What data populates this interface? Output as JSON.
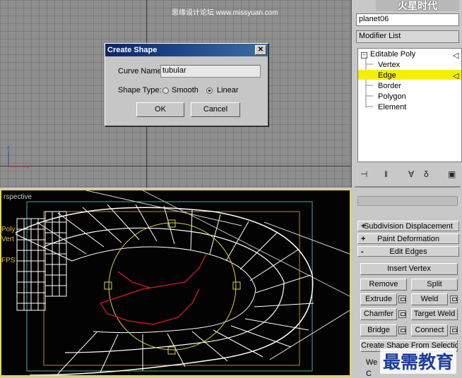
{
  "top_viewport": {
    "watermark": "思缘设计论坛 www.missyuan.com",
    "axis_z": "z",
    "axis_x": "x"
  },
  "dialog": {
    "title": "Create Shape",
    "close_glyph": "✕",
    "curve_name_label": "Curve Name:",
    "curve_name_value": "tubular",
    "shape_type_label": "Shape Type:",
    "option_smooth": "Smooth",
    "option_linear": "Linear",
    "selected_option": "Linear",
    "ok_label": "OK",
    "cancel_label": "Cancel"
  },
  "right_panel": {
    "logo_text": "火星时代",
    "object_name": "planet06",
    "modifier_list_label": "Modifier List",
    "stack": {
      "root": "Editable Poly",
      "items": [
        "Vertex",
        "Edge",
        "Border",
        "Polygon",
        "Element"
      ],
      "selected": "Edge"
    },
    "icons": [
      "pin-stack-icon",
      "show-end-result-icon",
      "make-unique-icon",
      "remove-modifier-icon",
      "configure-sets-icon"
    ],
    "rollouts": [
      {
        "sign": "+",
        "label": "Subdivision Displacement"
      },
      {
        "sign": "+",
        "label": "Paint Deformation"
      },
      {
        "sign": "-",
        "label": "Edit Edges"
      }
    ],
    "buttons": {
      "insert_vertex": "Insert Vertex",
      "remove": "Remove",
      "split": "Split",
      "extrude": "Extrude",
      "weld": "Weld",
      "chamfer": "Chamfer",
      "target_weld": "Target Weld",
      "bridge": "Bridge",
      "connect": "Connect",
      "create_shape": "Create Shape From Selection"
    },
    "partial_labels": [
      "We",
      "C"
    ]
  },
  "perspective_viewport": {
    "label": "rspective",
    "side_labels": [
      "Poly",
      "Vert",
      "FPS"
    ]
  },
  "bottom_watermark": "最需教育",
  "colors": {
    "viewport_grid": "#8e8e8e",
    "active_border": "#e6d84a",
    "selection_highlight": "#f5f000",
    "title_bar": "#0a246a",
    "wire_white": "#ffffff",
    "wire_red": "#c01818"
  }
}
